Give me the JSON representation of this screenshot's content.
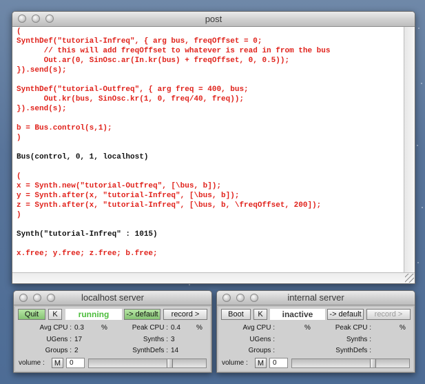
{
  "post_window": {
    "title": "post",
    "lines": [
      {
        "text": "(",
        "color": "red"
      },
      {
        "text": "SynthDef(\"tutorial-Infreq\", { arg bus, freqOffset = 0;",
        "color": "red"
      },
      {
        "text": "      // this will add freqOffset to whatever is read in from the bus",
        "color": "red"
      },
      {
        "text": "      Out.ar(0, SinOsc.ar(In.kr(bus) + freqOffset, 0, 0.5));",
        "color": "red"
      },
      {
        "text": "}).send(s);",
        "color": "red"
      },
      {
        "text": "",
        "color": "red"
      },
      {
        "text": "SynthDef(\"tutorial-Outfreq\", { arg freq = 400, bus;",
        "color": "red"
      },
      {
        "text": "      Out.kr(bus, SinOsc.kr(1, 0, freq/40, freq));",
        "color": "red"
      },
      {
        "text": "}).send(s);",
        "color": "red"
      },
      {
        "text": "",
        "color": "red"
      },
      {
        "text": "b = Bus.control(s,1);",
        "color": "red"
      },
      {
        "text": ")",
        "color": "red"
      },
      {
        "text": "",
        "color": "red"
      },
      {
        "text": "Bus(control, 0, 1, localhost)",
        "color": "black"
      },
      {
        "text": "",
        "color": "red"
      },
      {
        "text": "(",
        "color": "red"
      },
      {
        "text": "x = Synth.new(\"tutorial-Outfreq\", [\\bus, b]);",
        "color": "red"
      },
      {
        "text": "y = Synth.after(x, \"tutorial-Infreq\", [\\bus, b]);",
        "color": "red"
      },
      {
        "text": "z = Synth.after(x, \"tutorial-Infreq\", [\\bus, b, \\freqOffset, 200]);",
        "color": "red"
      },
      {
        "text": ")",
        "color": "red"
      },
      {
        "text": "",
        "color": "red"
      },
      {
        "text": "Synth(\"tutorial-Infreq\" : 1015)",
        "color": "black"
      },
      {
        "text": "",
        "color": "red"
      },
      {
        "text": "x.free; y.free; z.free; b.free;",
        "color": "red"
      }
    ]
  },
  "localhost_server": {
    "title": "localhost server",
    "quit_label": "Quit",
    "k_label": "K",
    "status": "running",
    "default_label": "-> default",
    "record_label": "record >",
    "avg_cpu_label": "Avg CPU :",
    "avg_cpu_value": "0.3",
    "pct": "%",
    "peak_cpu_label": "Peak CPU :",
    "peak_cpu_value": "0.4",
    "ugens_label": "UGens :",
    "ugens_value": "17",
    "synths_label": "Synths :",
    "synths_value": "3",
    "groups_label": "Groups :",
    "groups_value": "2",
    "synthdefs_label": "SynthDefs :",
    "synthdefs_value": "14",
    "volume_label": "volume :",
    "mute_label": "M",
    "volume_value": "0"
  },
  "internal_server": {
    "title": "internal server",
    "boot_label": "Boot",
    "k_label": "K",
    "status": "inactive",
    "default_label": "-> default",
    "record_label": "record >",
    "avg_cpu_label": "Avg CPU :",
    "pct": "%",
    "peak_cpu_label": "Peak CPU :",
    "ugens_label": "UGens :",
    "synths_label": "Synths :",
    "groups_label": "Groups :",
    "synthdefs_label": "SynthDefs :",
    "volume_label": "volume :",
    "mute_label": "M",
    "volume_value": "0"
  },
  "colors": {
    "code_red": "#e0221b",
    "running_green": "#4cbd3c",
    "button_green": "#86c374"
  }
}
